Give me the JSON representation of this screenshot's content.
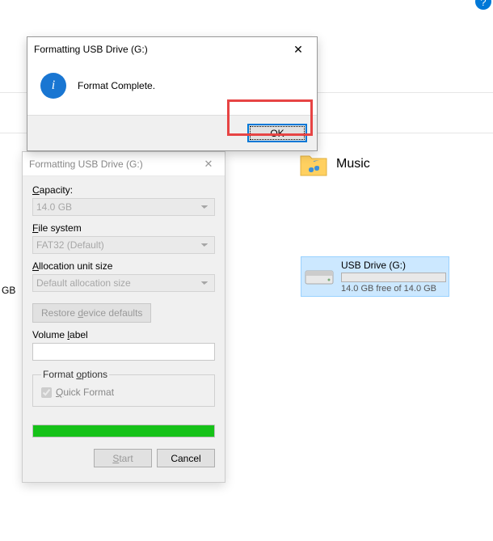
{
  "explorer": {
    "music_label": "Music",
    "drive_name": "USB Drive (G:)",
    "drive_free": "14.0 GB free of 14.0 GB",
    "gb_truncated": "GB"
  },
  "msg_dialog": {
    "title": "Formatting USB Drive (G:)",
    "message": "Format Complete.",
    "ok_label": "OK"
  },
  "fmt_dialog": {
    "title": "Formatting USB Drive (G:)",
    "capacity_label": "Capacity:",
    "capacity_value": "14.0 GB",
    "filesystem_label_pre": "",
    "filesystem_label": "File system",
    "filesystem_value": "FAT32 (Default)",
    "allocation_label": "Allocation unit size",
    "allocation_value": "Default allocation size",
    "restore_label": "Restore device defaults",
    "volume_label": "Volume label",
    "volume_value": "",
    "options_label": "Format options",
    "quick_format_label": "Quick Format",
    "start_label": "Start",
    "cancel_label": "Cancel"
  }
}
